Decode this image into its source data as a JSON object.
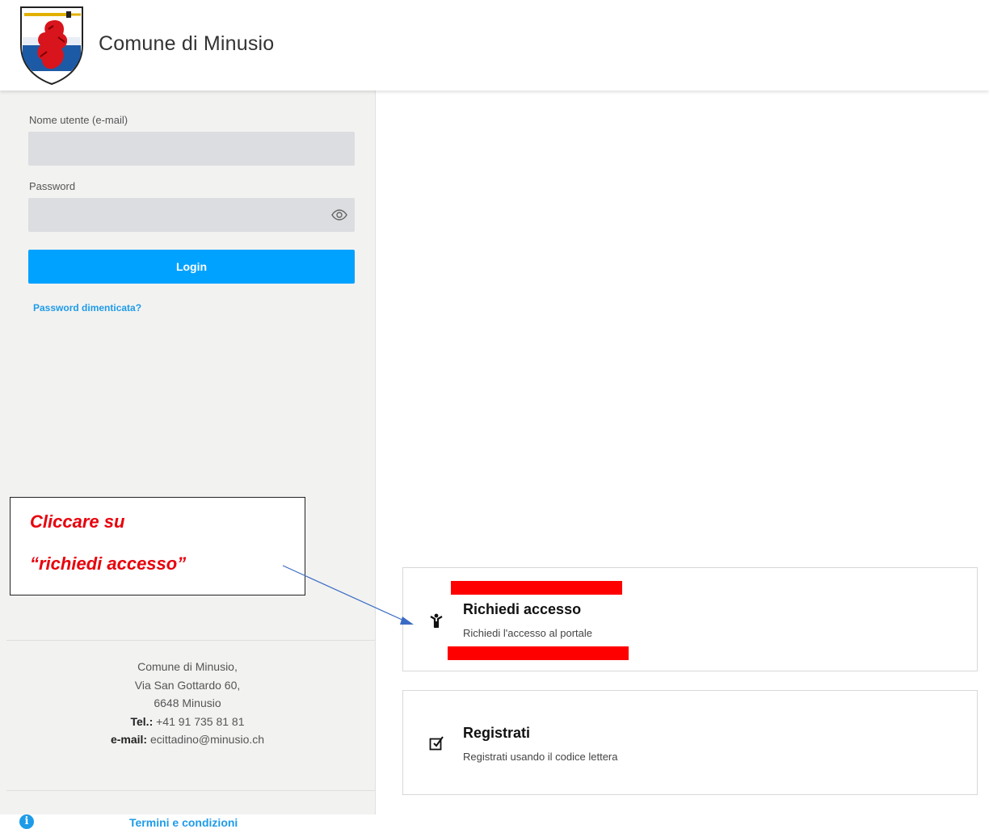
{
  "header": {
    "brand": "Comune di Minusio",
    "crest_icon": "coat-of-arms-logo"
  },
  "login": {
    "username_label": "Nome utente (e-mail)",
    "username_value": "",
    "password_label": "Password",
    "password_value": "",
    "login_label": "Login",
    "forgot_label": "Password dimenticata?",
    "accent_color": "#00a2ff"
  },
  "footer": {
    "address_line1": "Comune di Minusio,",
    "address_line2": "Via San Gottardo 60,",
    "address_line3": "6648 Minusio",
    "tel_label": "Tel.:",
    "tel_value": "+41 91 735 81 81",
    "email_label": "e-mail:",
    "email_value": "ecittadino@minusio.ch",
    "terms_label": "Termini e condizioni",
    "info_icon": "info-icon"
  },
  "cards": {
    "request": {
      "title": "Richiedi accesso",
      "subtitle": "Richiedi l'accesso al portale",
      "icon": "person-icon"
    },
    "register": {
      "title": "Registrati",
      "subtitle": "Registrati usando il codice lettera",
      "icon": "edit-checkbox-icon"
    }
  },
  "annotation": {
    "line1": "Cliccare su",
    "line2": "“richiedi accesso”",
    "highlight_color": "#ff0000"
  }
}
